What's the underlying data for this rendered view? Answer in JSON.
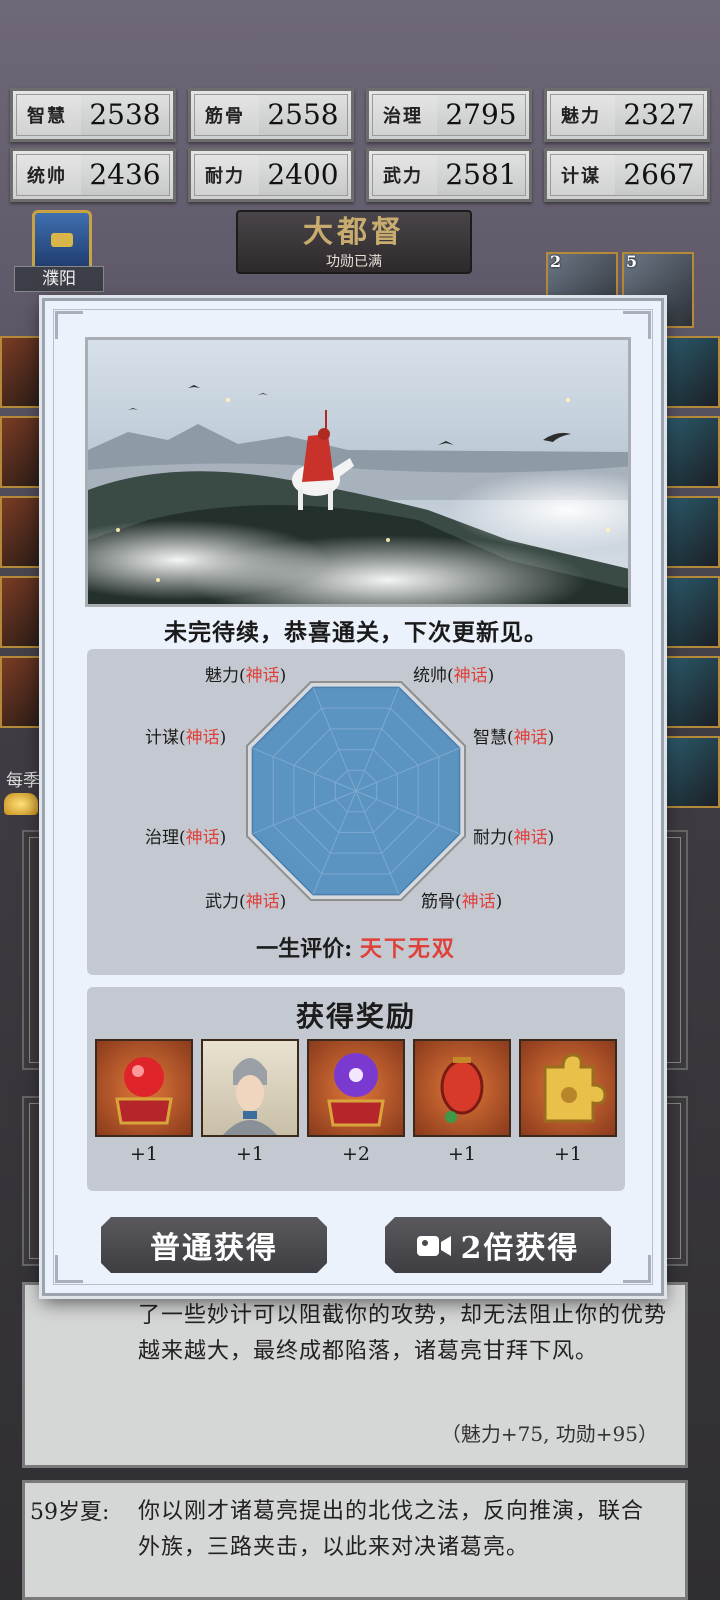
{
  "stats": [
    {
      "label": "智慧",
      "value": "2538"
    },
    {
      "label": "筋骨",
      "value": "2558"
    },
    {
      "label": "治理",
      "value": "2795"
    },
    {
      "label": "魅力",
      "value": "2327"
    },
    {
      "label": "统帅",
      "value": "2436"
    },
    {
      "label": "耐力",
      "value": "2400"
    },
    {
      "label": "武力",
      "value": "2581"
    },
    {
      "label": "计谋",
      "value": "2667"
    }
  ],
  "background": {
    "rank_title": "大都督",
    "rank_sub": "功勋已满",
    "city_name": "濮阳",
    "left_note": "每季",
    "hero_badges": [
      "2",
      "5"
    ]
  },
  "modal": {
    "ending_text": "未完待续，恭喜通关，下次更新见。",
    "radar": {
      "axes": [
        {
          "name": "魅力",
          "grade": "神话"
        },
        {
          "name": "统帅",
          "grade": "神话"
        },
        {
          "name": "计谋",
          "grade": "神话"
        },
        {
          "name": "智慧",
          "grade": "神话"
        },
        {
          "name": "治理",
          "grade": "神话"
        },
        {
          "name": "耐力",
          "grade": "神话"
        },
        {
          "name": "武力",
          "grade": "神话"
        },
        {
          "name": "筋骨",
          "grade": "神话"
        }
      ],
      "fill_level": 0.95,
      "fill_color": "#5b93c1",
      "outline_color": "#8f8f8f"
    },
    "evaluation_label": "一生评价:",
    "evaluation_value": "天下无双",
    "reward_title": "获得奖励",
    "rewards": [
      {
        "icon": "red-orb-chest-icon",
        "count": "+1"
      },
      {
        "icon": "general-portrait-icon",
        "count": "+1"
      },
      {
        "icon": "purple-orb-chest-icon",
        "count": "+2"
      },
      {
        "icon": "red-lantern-icon",
        "count": "+1"
      },
      {
        "icon": "puzzle-piece-icon",
        "count": "+1"
      }
    ],
    "btn_normal": "普通获得",
    "btn_double": "2倍获得",
    "accent_red": "#e0403a"
  },
  "log": {
    "text": "了一些妙计可以阻截你的攻势，却无法阻止你的优势越来越大，最终成都陷落，诸葛亮甘拜下风。",
    "reward": "（魅力+75, 功勋+95）",
    "entry2_age": "59岁夏:",
    "entry2_text": "你以刚才诸葛亮提出的北伐之法，反向推演，联合外族，三路夹击，以此来对决诸葛亮。"
  }
}
